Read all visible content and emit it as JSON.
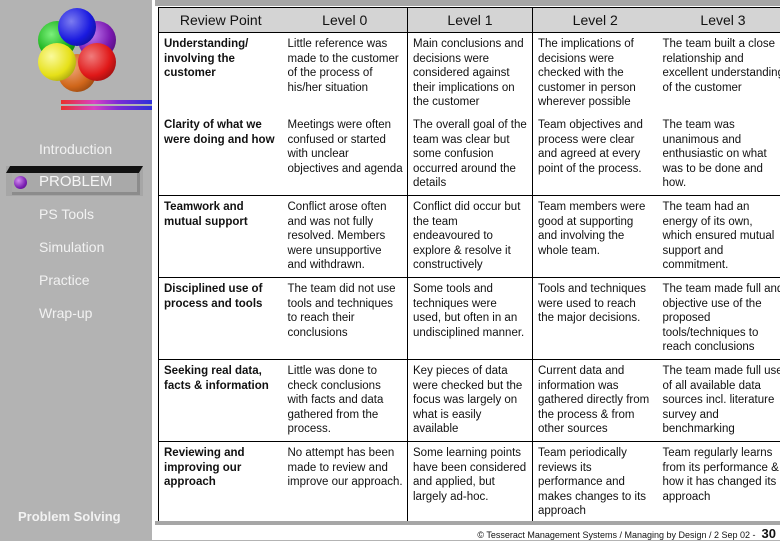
{
  "sidebar": {
    "logo_colors": {
      "blue": "#1a1ae0",
      "green": "#18b018",
      "purple": "#7a18b0",
      "yellow": "#e6e018",
      "red": "#e01818",
      "orange": "#d0661a"
    },
    "items": [
      {
        "label": "Introduction"
      },
      {
        "label": "PROBLEM",
        "active": true
      },
      {
        "label": "PS Tools"
      },
      {
        "label": "Simulation"
      },
      {
        "label": "Practice"
      },
      {
        "label": "Wrap-up"
      }
    ],
    "footer": "Problem Solving"
  },
  "table": {
    "headers": [
      "Review Point",
      "Level 0",
      "Level 1",
      "Level 2",
      "Level 3"
    ],
    "rows": [
      [
        "Understanding/ involving the customer",
        "Little reference was made to the customer of the process of his/her situation",
        "Main conclusions and decisions were considered against their implications on the customer",
        "The implications of decisions were checked with the customer in person wherever possible",
        "The team built a close relationship and excellent understanding of the customer"
      ],
      [
        "Clarity of what we were doing and how",
        "Meetings were often confused or started with unclear objectives and agenda",
        "The overall goal of the team was clear but some confusion occurred around the details",
        "Team objectives and process were clear and agreed at every point of the process.",
        "The team was unanimous and enthusiastic on what was to be done and how."
      ],
      [
        "Teamwork and mutual support",
        "Conflict arose often and was not fully resolved. Members were unsupportive and withdrawn.",
        "Conflict did occur but the team endeavoured to explore & resolve it constructively",
        "Team members were good at supporting and involving the whole team.",
        "The team had an energy of its own, which ensured mutual support and commitment."
      ],
      [
        "Disciplined use of process and tools",
        "The team did not use tools and techniques to reach their conclusions",
        "Some tools and techniques were used, but often in an undisciplined manner.",
        "Tools and techniques were used to reach the major decisions.",
        "The team made full and objective use of the proposed tools/techniques to reach conclusions"
      ],
      [
        "Seeking real data, facts & information",
        "Little was done to check conclusions with facts and data gathered from the process.",
        "Key pieces of data were checked but the focus was largely on what is easily available",
        "Current data and information was gathered directly from the process & from other sources",
        "The team made full use of all available data sources incl. literature survey and benchmarking"
      ],
      [
        "Reviewing and improving our approach",
        "No attempt has been made to review and improve our approach.",
        "Some learning points have been considered and applied, but largely ad-hoc.",
        "Team periodically reviews its performance and makes changes to its approach",
        "Team regularly learns from its performance & how it has changed its approach"
      ]
    ]
  },
  "footer": {
    "copyright": "© Tesseract Management Systems / Managing by Design / 2 Sep 02  -",
    "page": "30"
  }
}
